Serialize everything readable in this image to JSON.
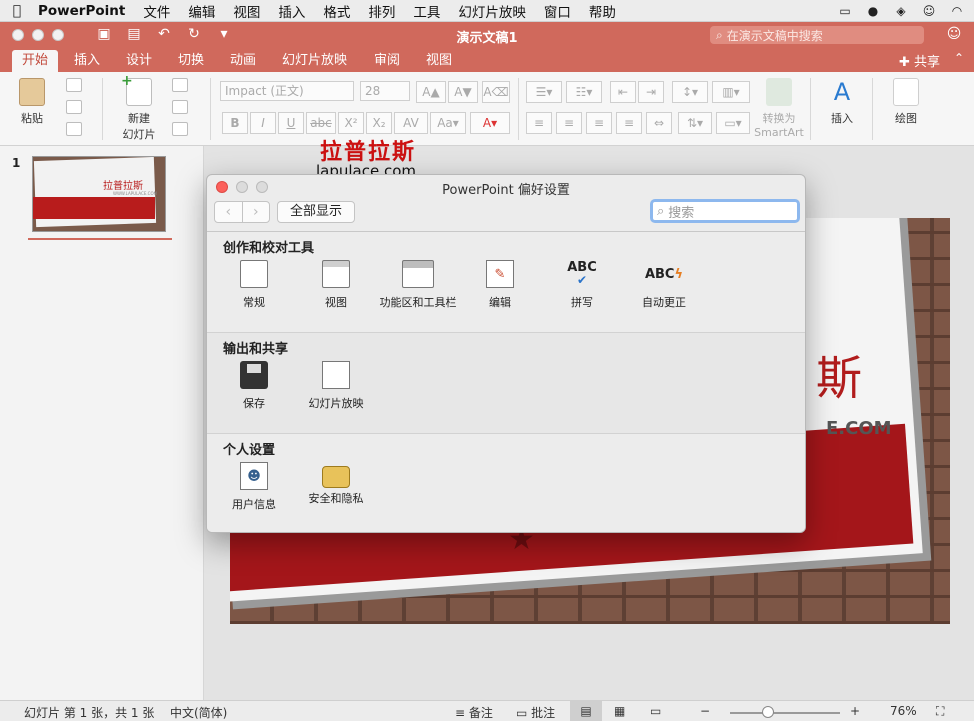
{
  "menubar": {
    "app_name": "PowerPoint",
    "items": [
      "文件",
      "编辑",
      "视图",
      "插入",
      "格式",
      "排列",
      "工具",
      "幻灯片放映",
      "窗口",
      "帮助"
    ]
  },
  "window": {
    "title": "演示文稿1",
    "search_placeholder": "在演示文稿中搜索",
    "share": "共享"
  },
  "tabs": [
    "开始",
    "插入",
    "设计",
    "切换",
    "动画",
    "幻灯片放映",
    "审阅",
    "视图"
  ],
  "ribbon": {
    "paste": "粘贴",
    "new_slide_l1": "新建",
    "new_slide_l2": "幻灯片",
    "font_name": "Impact (正文)",
    "font_size": "28",
    "bold": "B",
    "italic": "I",
    "underline": "U",
    "strike": "abc",
    "superscript": "X²",
    "subscript": "X₂",
    "char_spacing": "AV",
    "smartart_l1": "转换为",
    "smartart_l2": "SmartArt",
    "insert": "插入",
    "draw": "绘图"
  },
  "thumbnail": {
    "number": "1",
    "title": "拉普拉斯",
    "url": "WWW.LAPULACE.COM"
  },
  "slide": {
    "big_text": "斯",
    "url_text": "E.COM"
  },
  "watermark": {
    "cn": "拉普拉斯",
    "en": "lapulace.com"
  },
  "dialog": {
    "title": "PowerPoint 偏好设置",
    "show_all": "全部显示",
    "search_placeholder": "搜索",
    "sections": [
      {
        "title": "创作和校对工具",
        "items": [
          "常规",
          "视图",
          "功能区和工具栏",
          "编辑",
          "拼写",
          "自动更正"
        ]
      },
      {
        "title": "输出和共享",
        "items": [
          "保存",
          "幻灯片放映"
        ]
      },
      {
        "title": "个人设置",
        "items": [
          "用户信息",
          "安全和隐私"
        ]
      }
    ],
    "spell_glyph": "ABC",
    "autocorrect_glyph": "ABC"
  },
  "statusbar": {
    "slide_info": "幻灯片 第 1 张，共 1 张",
    "language": "中文(简体)",
    "notes": "备注",
    "comments": "批注",
    "zoom": "76%",
    "zoom_level_percent": 76
  },
  "colors": {
    "accent": "#d0695c",
    "slide_red": "#a4161a",
    "search_focus": "#8db8ee"
  }
}
